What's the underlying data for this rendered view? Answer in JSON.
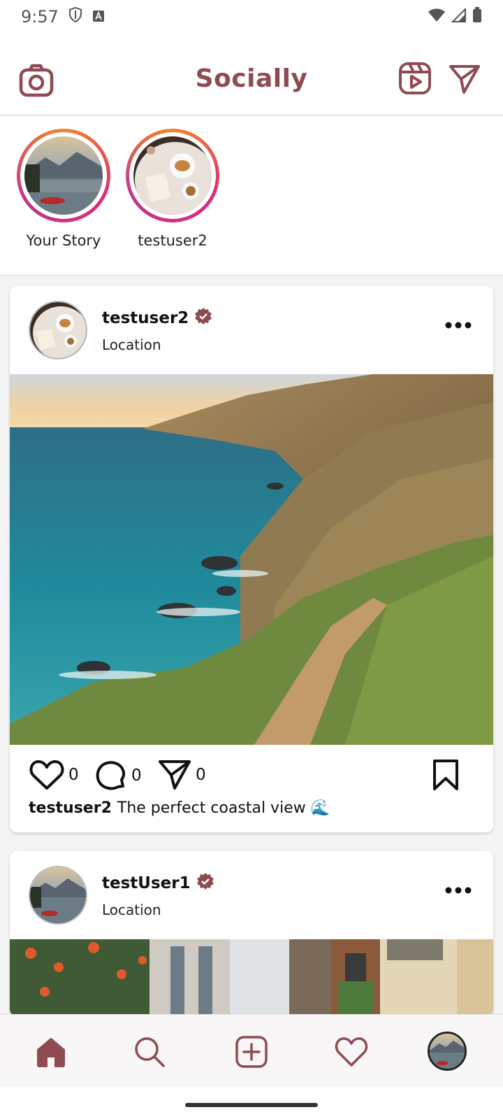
{
  "status_bar": {
    "time": "9:57"
  },
  "app": {
    "title": "Socially",
    "brand_color": "#8e4b52"
  },
  "stories": [
    {
      "label": "Your Story"
    },
    {
      "label": "testuser2"
    }
  ],
  "posts": [
    {
      "username": "testuser2",
      "location": "Location",
      "likes": "0",
      "comments": "0",
      "shares": "0",
      "caption_user": "testuser2",
      "caption_text": "The perfect coastal view 🌊"
    },
    {
      "username": "testUser1",
      "location": "Location"
    }
  ],
  "nav": [
    "home-icon",
    "search-icon",
    "add-post-icon",
    "activity-heart-icon",
    "profile-avatar"
  ]
}
